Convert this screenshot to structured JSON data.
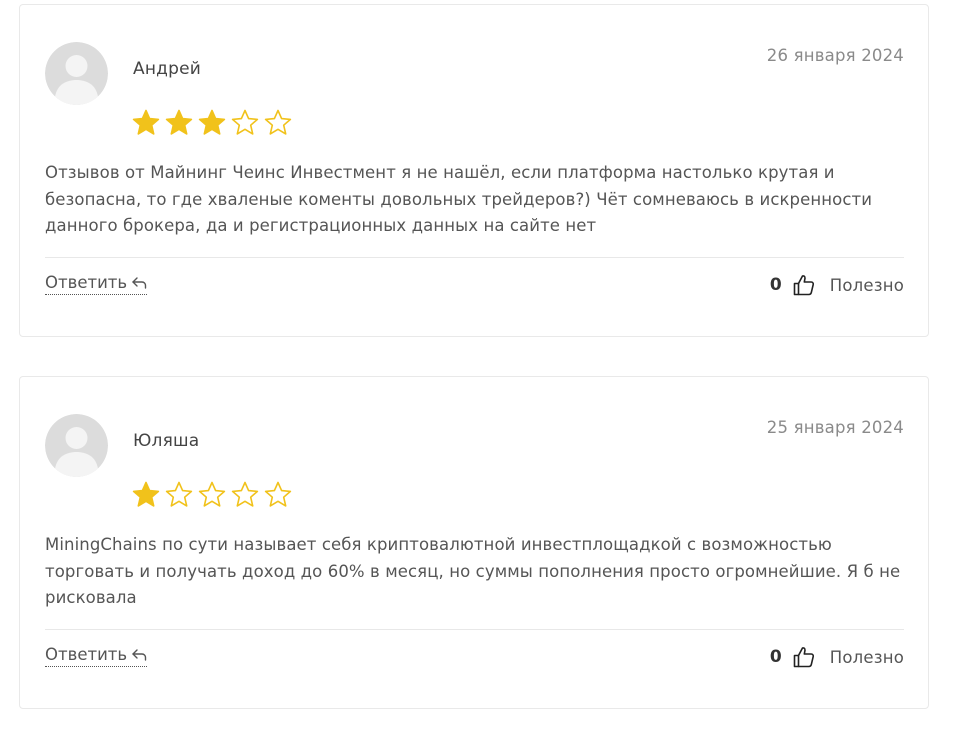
{
  "reviews": [
    {
      "author": "Андрей",
      "date": "26 января 2024",
      "rating": 3,
      "text": "Отзывов от Майнинг Чеинс Инвестмент я не нашёл, если платформа настолько крутая и безопасна, то где хваленые коменты довольных трейдеров?) Чёт сомневаюсь в искренности данного брокера, да и регистрационных данных на сайте нет",
      "reply_label": "Ответить",
      "likes": "0",
      "useful_label": "Полезно"
    },
    {
      "author": "Юляша",
      "date": "25 января 2024",
      "rating": 1,
      "text": "MiningChains по сути называет себя криптовалютной инвестплощадкой с возможностью торговать и получать доход до 60% в месяц, но суммы пополнения просто огромнейшие. Я б не рисковала",
      "reply_label": "Ответить",
      "likes": "0",
      "useful_label": "Полезно"
    }
  ],
  "icons": {
    "star_filled": "star-filled-icon",
    "star_empty": "star-outline-icon",
    "reply": "reply-arrow-icon",
    "like": "thumbs-up-icon",
    "avatar": "user-avatar-placeholder"
  },
  "colors": {
    "star": "#F1C21B",
    "border": "#E9E9E9",
    "text": "#555555",
    "date": "#8A8A8A"
  }
}
